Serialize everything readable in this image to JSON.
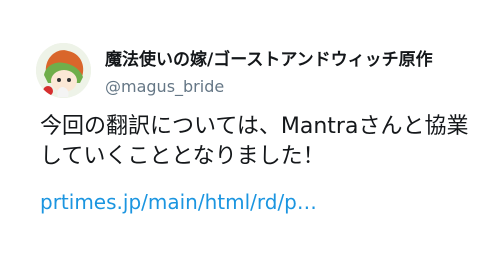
{
  "tweet": {
    "author": {
      "display_name": "魔法使いの嫁/ゴーストアンドウィッチ原作",
      "handle": "@magus_bride",
      "avatar_icon": "anime-character-avatar-icon"
    },
    "text_lines": [
      "今回の翻訳については、Mantraさんと協業",
      "していくこととなりました！"
    ],
    "link_text": "prtimes.jp/main/html/rd/p…"
  },
  "colors": {
    "text": "#14171a",
    "secondary": "#657786",
    "link": "#1b95e0"
  }
}
